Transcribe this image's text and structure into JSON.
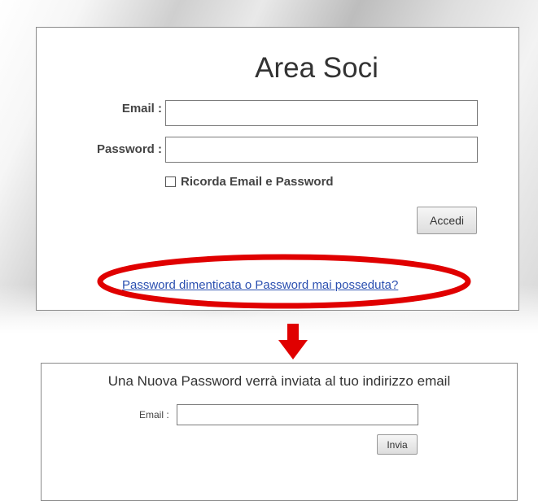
{
  "login": {
    "title": "Area Soci",
    "email_label": "Email :",
    "email_value": "",
    "password_label": "Password :",
    "password_value": "",
    "remember_label": "Ricorda Email e Password",
    "remember_checked": false,
    "submit_label": "Accedi",
    "forgot_link": "Password dimenticata o Password mai posseduta?"
  },
  "reset": {
    "message": "Una Nuova Password verrà inviata al tuo indirizzo email",
    "email_label": "Email :",
    "email_value": "",
    "submit_label": "Invia"
  },
  "annotations": {
    "highlight_color": "#e00000",
    "highlight_shape": "ellipse",
    "arrow_direction": "down"
  },
  "icons": [
    "checkbox-icon",
    "arrow-down-icon",
    "highlight-ellipse"
  ]
}
